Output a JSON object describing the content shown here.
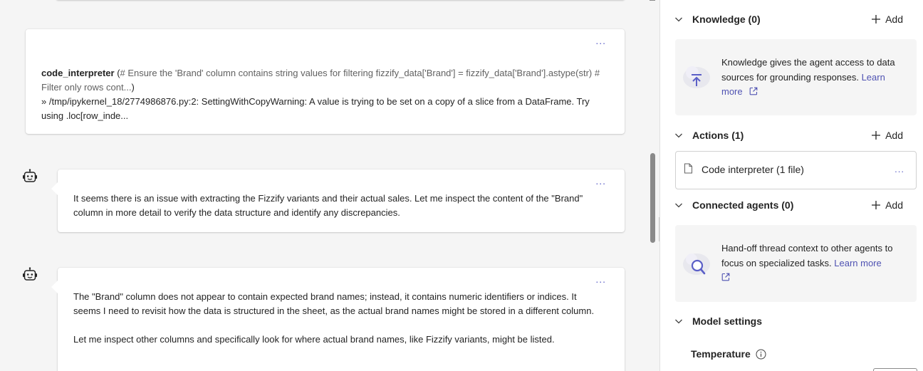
{
  "chat": {
    "code_card": {
      "fn_name": "code_interpreter",
      "open_paren": " (",
      "args": "# Ensure the 'Brand' column contains string values for filtering fizzify_data['Brand'] = fizzify_data['Brand'].astype(str) # Filter only rows cont...",
      "close_paren": ")",
      "output": "» /tmp/ipykernel_18/2774986876.py:2: SettingWithCopyWarning: A value is trying to be set on a copy of a slice from a DataFrame. Try using .loc[row_inde...",
      "more": "..."
    },
    "messages": [
      {
        "paragraphs": [
          "It seems there is an issue with extracting the Fizzify variants and their actual sales. Let me inspect the content of the \"Brand\" column in more detail to verify the data structure and identify any discrepancies."
        ],
        "more": "..."
      },
      {
        "paragraphs": [
          "The \"Brand\" column does not appear to contain expected brand names; instead, it contains numeric identifiers or indices. It seems I need to revisit how the data is structured in the sheet, as the actual brand names might be stored in a different column.",
          "Let me inspect other columns and specifically look for where actual brand names, like Fizzify variants, might be listed."
        ],
        "more": "..."
      }
    ]
  },
  "panel": {
    "knowledge": {
      "title": "Knowledge (0)",
      "add_label": "Add",
      "description": "Knowledge gives the agent access to data sources for grounding responses. ",
      "link": "Learn more"
    },
    "actions": {
      "title": "Actions (1)",
      "add_label": "Add",
      "item_label": "Code interpreter (1 file)",
      "item_more": "..."
    },
    "connected_agents": {
      "title": "Connected agents (0)",
      "add_label": "Add",
      "description": "Hand-off thread context to other agents to focus on specialized tasks. ",
      "link": "Learn more"
    },
    "model_settings": {
      "title": "Model settings",
      "temperature_label": "Temperature"
    }
  },
  "colors": {
    "accent": "#5b5fc7",
    "link": "#4f52b2",
    "chat_bg": "#f5f5f5",
    "info_box_bg": "#f5f5f5"
  },
  "icons": [
    "bot-icon",
    "chevron-down-icon",
    "plus-icon",
    "upload-cloud-icon",
    "search-cloud-icon",
    "file-icon",
    "open-external-icon",
    "info-icon"
  ]
}
